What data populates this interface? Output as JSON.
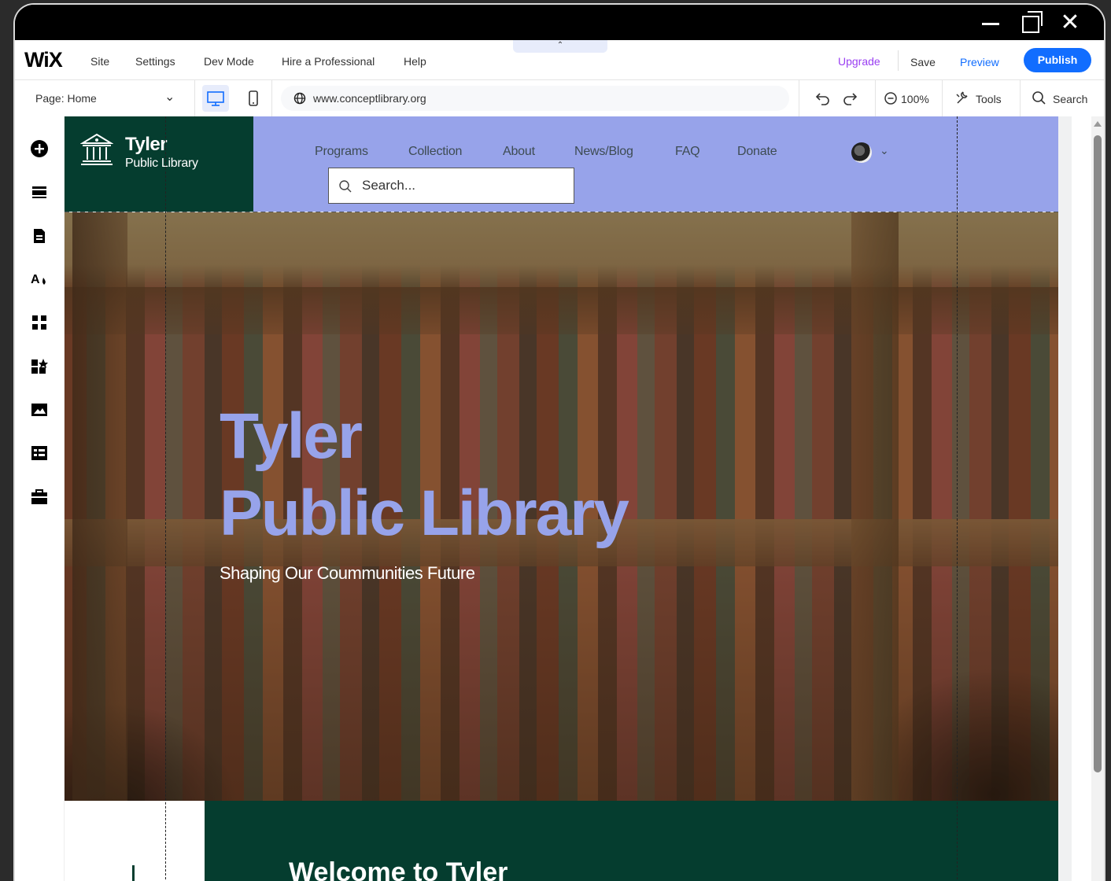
{
  "window_controls": {
    "minimize": "minimize-icon",
    "maximize": "maximize-icon",
    "close": "close-icon"
  },
  "topbar": {
    "logo": "WiX",
    "menu": [
      "Site",
      "Settings",
      "Dev Mode",
      "Hire a Professional",
      "Help"
    ],
    "upgrade": "Upgrade",
    "save": "Save",
    "preview": "Preview",
    "publish": "Publish",
    "colors": {
      "upgrade": "#9a3ff2",
      "preview": "#116dff",
      "publish_bg": "#116dff"
    }
  },
  "toolbar": {
    "page_label": "Page: Home",
    "url": "www.conceptlibrary.org",
    "zoom": "100%",
    "tools": "Tools",
    "search": "Search"
  },
  "left_panel_icons": [
    "add-elements-icon",
    "sections-icon",
    "pages-icon",
    "site-design-icon",
    "add-apps-icon",
    "business-solutions-icon",
    "media-icon",
    "cms-icon",
    "portfolio-icon"
  ],
  "site": {
    "brand_title": "Tyler",
    "brand_subtitle": "Public Library",
    "nav": [
      "Programs",
      "Collection",
      "About",
      "News/Blog",
      "FAQ",
      "Donate"
    ],
    "search_placeholder": "Search...",
    "hero_title_line1": "Tyler",
    "hero_title_line2": "Public Library",
    "hero_tagline": "Shaping Our Coummunities Future",
    "welcome_heading": "Welcome to Tyler",
    "colors": {
      "header_bg": "#97a3ea",
      "brand_bg": "#053d2f",
      "hero_title": "#97a3ea"
    }
  }
}
